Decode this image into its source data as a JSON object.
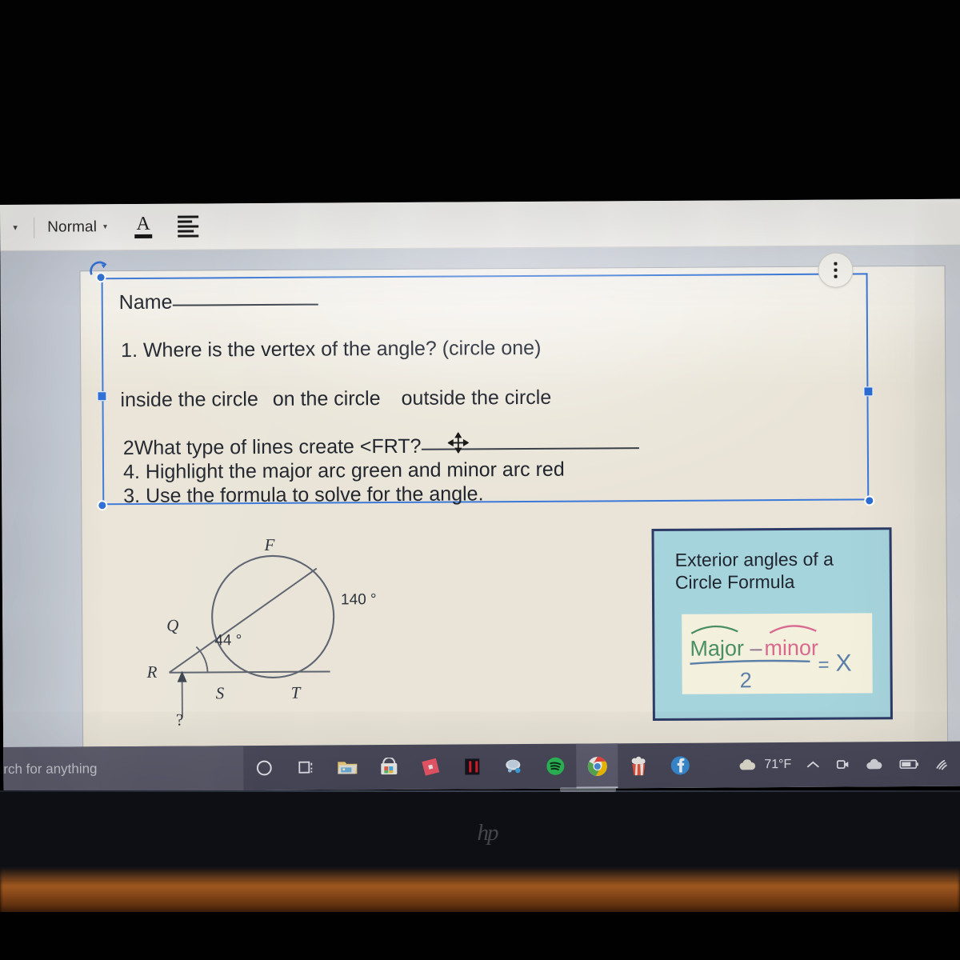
{
  "toolbar": {
    "dropdown_chevron": "chevron-down-icon",
    "style_label": "Normal",
    "style_caret": "▾",
    "text_color_label": "A",
    "align_icon": "align-left-icon"
  },
  "document": {
    "name_label": "Name",
    "question_1": "1. Where is the vertex of the angle? (circle one)",
    "options": [
      "inside the circle",
      "on  the circle",
      "outside the circle"
    ],
    "question_2_prefix": "2What type of lines create <FRT?",
    "question_4": "4. Highlight the major arc green and minor arc red",
    "question_3": "3. Use the formula to solve for the angle.",
    "more_options_icon": "vertical-ellipsis-icon",
    "rotate_handle_icon": "rotate-handle-icon",
    "move_cursor_icon": "move-cursor-icon"
  },
  "figure": {
    "labels": {
      "F": "F",
      "Q": "Q",
      "R": "R",
      "S": "S",
      "T": "T",
      "unknown": "?"
    },
    "angle_interior": "44 °",
    "arc_major": "140 °"
  },
  "formula_card": {
    "title_line_1": "Exterior angles of a",
    "title_line_2": "Circle Formula",
    "numerator_major": "Major",
    "numerator_minus": "–",
    "numerator_minor": "minor",
    "denominator": "2",
    "equals": "=",
    "result": "X",
    "colors": {
      "card_fill": "#a6d4dd",
      "card_border": "#2e3b66",
      "inner_fill": "#f3f0dd",
      "major_ink": "#4a8f62",
      "minor_ink": "#d9698e",
      "bar_ink": "#5b7fa8"
    }
  },
  "taskbar": {
    "search_placeholder": "rch for anything",
    "apps": [
      {
        "name": "cortana-icon",
        "label": "Cortana"
      },
      {
        "name": "task-view-icon",
        "label": "Task View"
      },
      {
        "name": "file-explorer-icon",
        "label": "File Explorer"
      },
      {
        "name": "microsoft-store-icon",
        "label": "Microsoft Store"
      },
      {
        "name": "roblox-icon",
        "label": "Roblox"
      },
      {
        "name": "netflix-icon",
        "label": "Netflix"
      },
      {
        "name": "paint-icon",
        "label": "Paint 3D"
      },
      {
        "name": "spotify-icon",
        "label": "Spotify"
      },
      {
        "name": "chrome-icon",
        "label": "Google Chrome"
      },
      {
        "name": "popcorn-icon",
        "label": "Popcorn"
      },
      {
        "name": "facebook-icon",
        "label": "Facebook"
      }
    ],
    "active_app": "chrome-icon",
    "tray": {
      "weather_icon": "cloud-icon",
      "temperature": "71°F",
      "show_hidden_icon": "chevron-up-icon",
      "meet_now_icon": "meet-now-icon",
      "onedrive_icon": "onedrive-cloud-icon",
      "battery_icon": "battery-icon",
      "network_icon": "wifi-icon"
    }
  },
  "hardware": {
    "brand_logo": "hp"
  }
}
